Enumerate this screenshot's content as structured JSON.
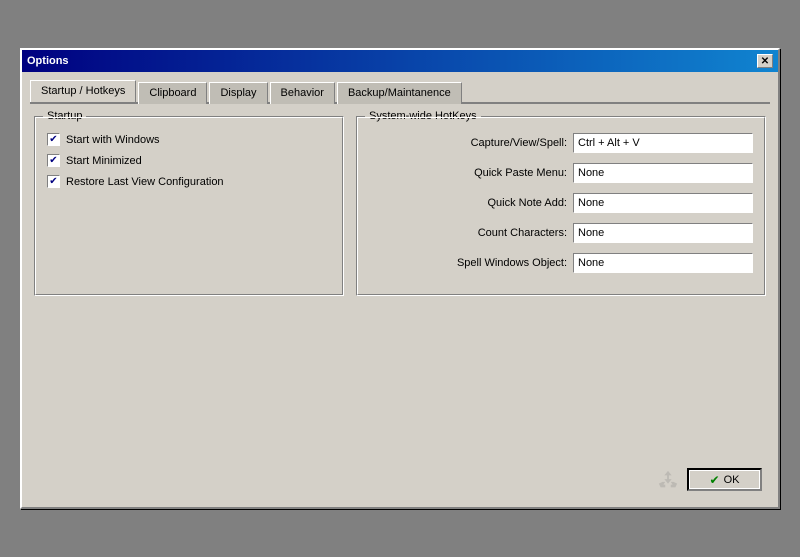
{
  "window": {
    "title": "Options",
    "close_label": "✕"
  },
  "tabs": [
    {
      "id": "startup-hotkeys",
      "label": "Startup / Hotkeys",
      "active": true
    },
    {
      "id": "clipboard",
      "label": "Clipboard",
      "active": false
    },
    {
      "id": "display",
      "label": "Display",
      "active": false
    },
    {
      "id": "behavior",
      "label": "Behavior",
      "active": false
    },
    {
      "id": "backup",
      "label": "Backup/Maintanence",
      "active": false
    }
  ],
  "startup_group": {
    "label": "Startup",
    "checkboxes": [
      {
        "id": "start-with-windows",
        "label": "Start with Windows",
        "checked": true
      },
      {
        "id": "start-minimized",
        "label": "Start Minimized",
        "checked": true
      },
      {
        "id": "restore-last-view",
        "label": "Restore Last View Configuration",
        "checked": true
      }
    ]
  },
  "hotkeys_group": {
    "label": "System-wide HotKeys",
    "rows": [
      {
        "id": "capture-view-spell",
        "label": "Capture/View/Spell:",
        "value": "Ctrl + Alt + V"
      },
      {
        "id": "quick-paste-menu",
        "label": "Quick Paste Menu:",
        "value": "None"
      },
      {
        "id": "quick-note-add",
        "label": "Quick Note Add:",
        "value": "None"
      },
      {
        "id": "count-characters",
        "label": "Count Characters:",
        "value": "None"
      },
      {
        "id": "spell-windows-object",
        "label": "Spell Windows Object:",
        "value": "None"
      }
    ]
  },
  "buttons": {
    "ok_label": "OK"
  }
}
